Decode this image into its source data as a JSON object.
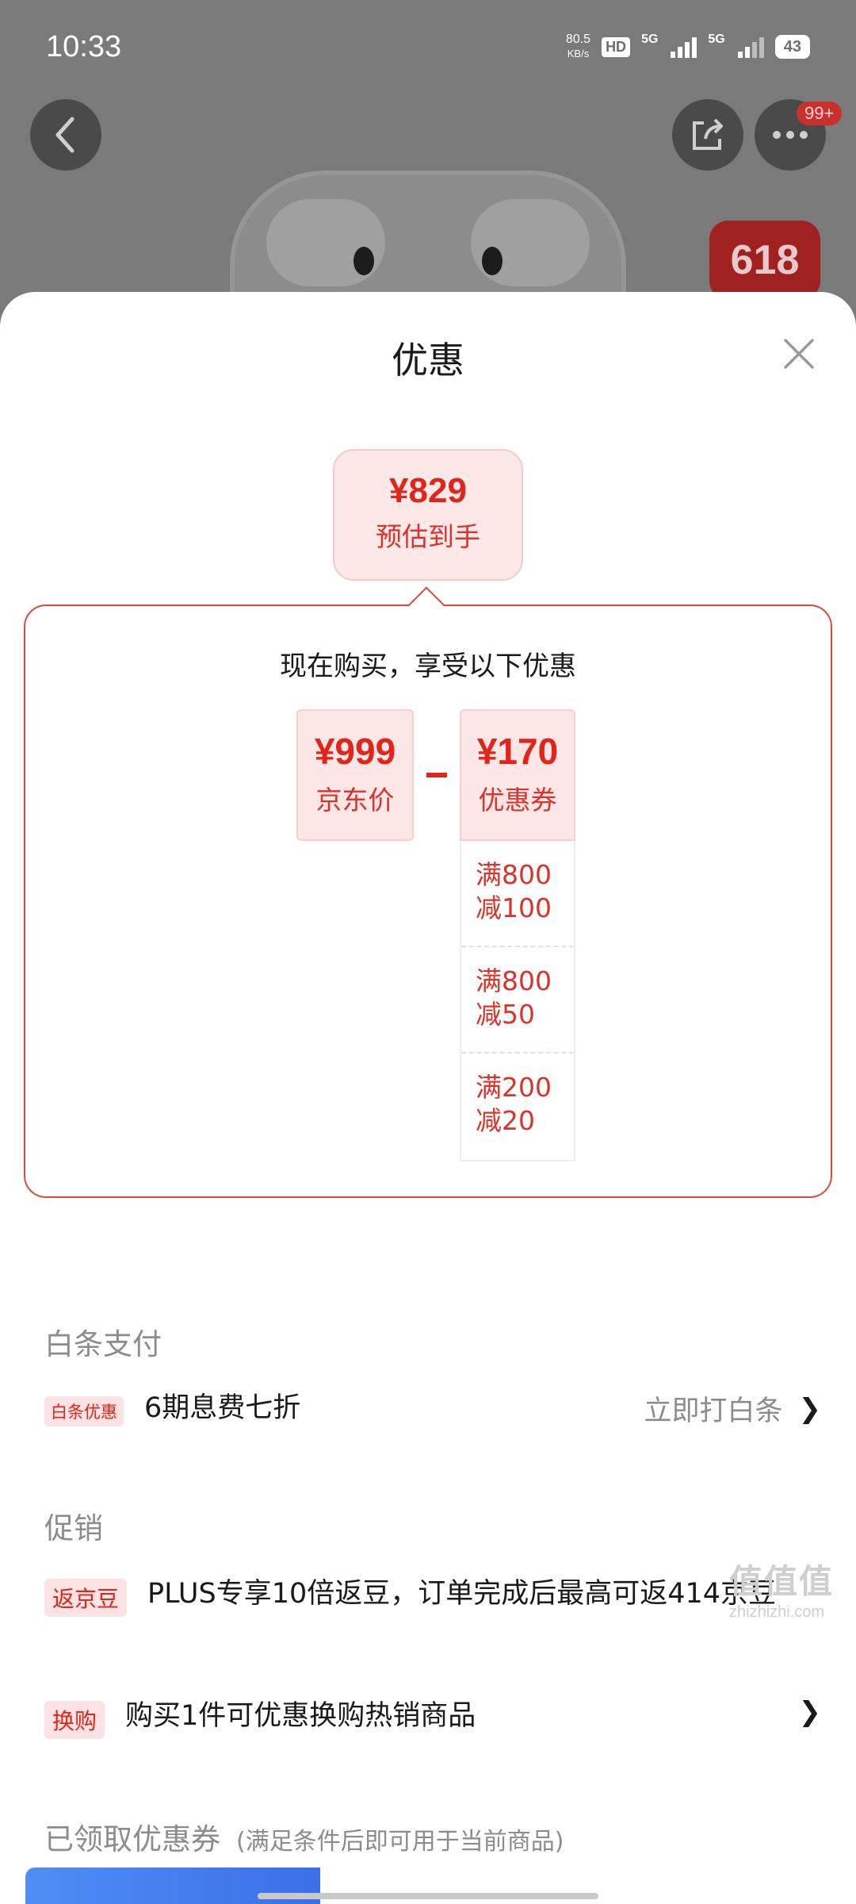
{
  "status_bar": {
    "time": "10:33",
    "net_speed_value": "80.5",
    "net_speed_unit": "KB/s",
    "hd_label": "HD",
    "sim1_label": "5G",
    "sim2_label": "5G",
    "battery": "43"
  },
  "background_page": {
    "more_badge": "99+",
    "promo_tag": "618"
  },
  "sheet": {
    "title": "优惠",
    "estimate": {
      "price": "¥829",
      "label": "预估到手"
    },
    "headline": "现在购买，享受以下优惠",
    "jd_price": {
      "amount": "¥999",
      "label": "京东价"
    },
    "coupon_total": {
      "amount": "¥170",
      "label": "优惠券"
    },
    "coupons": [
      {
        "line1": "满800",
        "line2": "减100"
      },
      {
        "line1": "满800",
        "line2": "减50"
      },
      {
        "line1": "满200",
        "line2": "减20"
      }
    ]
  },
  "baitiao": {
    "section_title": "白条支付",
    "tag": "白条优惠",
    "text": "6期息费七折",
    "action": "立即打白条"
  },
  "promotion": {
    "section_title": "促销",
    "items": [
      {
        "tag": "返京豆",
        "text": "PLUS专享10倍返豆，订单完成后最高可返414京豆"
      },
      {
        "tag": "换购",
        "text": "购买1件可优惠换购热销商品"
      }
    ]
  },
  "claimed_coupons": {
    "section_title": "已领取优惠券",
    "subtitle": "(满足条件后即可用于当前商品)"
  },
  "watermark": {
    "big": "值值值",
    "small": "zhizhizhi.com"
  },
  "colors": {
    "accent": "#e1251b",
    "accent_bg": "#fde6e6",
    "border": "#d94b3f"
  }
}
